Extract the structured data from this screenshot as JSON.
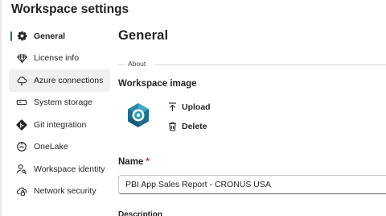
{
  "panel": {
    "title": "Workspace settings"
  },
  "sidebar": {
    "items": [
      {
        "label": "General",
        "icon": "gear-icon",
        "active": true
      },
      {
        "label": "License info",
        "icon": "diamond-icon"
      },
      {
        "label": "Azure connections",
        "icon": "cloud-plug-icon",
        "hover": true
      },
      {
        "label": "System storage",
        "icon": "storage-icon"
      },
      {
        "label": "Git integration",
        "icon": "git-icon"
      },
      {
        "label": "OneLake",
        "icon": "onelake-icon"
      },
      {
        "label": "Workspace identity",
        "icon": "person-key-icon"
      },
      {
        "label": "Network security",
        "icon": "cloud-lock-icon"
      }
    ]
  },
  "main": {
    "title": "General",
    "section_label": "About",
    "workspace_image": {
      "heading": "Workspace image",
      "upload_label": "Upload",
      "delete_label": "Delete"
    },
    "name": {
      "label": "Name",
      "required_marker": "*",
      "value": "PBI App Sales Report - CRONUS USA"
    },
    "next_label_partial": "Description"
  },
  "colors": {
    "accent": "#1b7a3a",
    "required": "#c4314b",
    "hover_bg": "#f0f0f0"
  }
}
